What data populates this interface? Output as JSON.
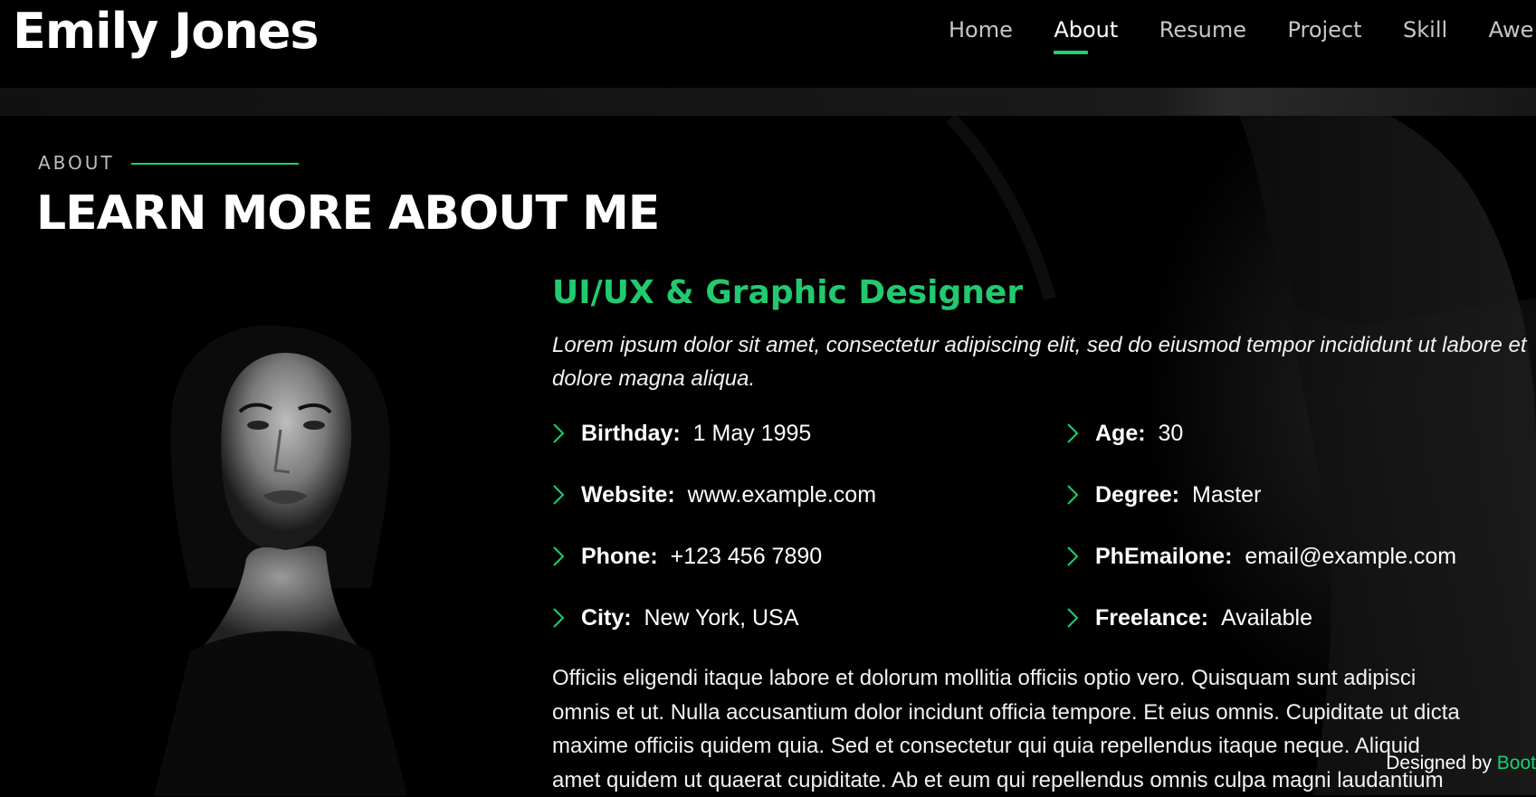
{
  "header": {
    "logo": "Emily Jones",
    "nav": [
      {
        "label": "Home"
      },
      {
        "label": "About"
      },
      {
        "label": "Resume"
      },
      {
        "label": "Project"
      },
      {
        "label": "Skill"
      },
      {
        "label": "Awe"
      }
    ],
    "active_nav": "About"
  },
  "about": {
    "section_label": "ABOUT",
    "headline": "LEARN MORE ABOUT ME",
    "role": "UI/UX & Graphic Designer",
    "intro": "Lorem ipsum dolor sit amet, consectetur adipiscing elit, sed do eiusmod tempor incididunt ut labore et dolore magna aliqua.",
    "facts": [
      {
        "label": "Birthday:",
        "value": "1 May 1995"
      },
      {
        "label": "Age:",
        "value": "30"
      },
      {
        "label": "Website:",
        "value": "www.example.com"
      },
      {
        "label": "Degree:",
        "value": "Master"
      },
      {
        "label": "Phone:",
        "value": "+123 456 7890"
      },
      {
        "label": "PhEmailone:",
        "value": "email@example.com"
      },
      {
        "label": "City:",
        "value": "New York, USA"
      },
      {
        "label": "Freelance:",
        "value": "Available"
      }
    ],
    "paragraph_lines": [
      "Officiis eligendi itaque labore et dolorum mollitia officiis optio vero. Quisquam sunt adipisci",
      "omnis et ut. Nulla accusantium dolor incidunt officia tempore. Et eius omnis. Cupiditate ut dicta",
      "maxime officiis quidem quia. Sed et consectetur qui quia repellendus itaque neque. Aliquid",
      "amet quidem ut quaerat cupiditate. Ab et eum qui repellendus omnis culpa magni laudantium"
    ]
  },
  "credits": {
    "prefix": "Designed by ",
    "link": "Boot"
  },
  "colors": {
    "accent": "#18d26e",
    "background": "#000000",
    "text": "#ffffff"
  }
}
